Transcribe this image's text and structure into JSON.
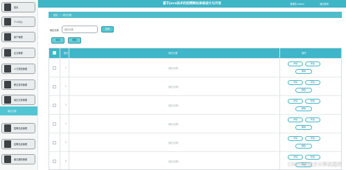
{
  "header": {
    "title": "基于java技术的招聘网站系统设计与开发",
    "user": "管理员 admin",
    "logout": "退出登录"
  },
  "sidebar": {
    "items": [
      {
        "label": "首页",
        "icon": "home-icon"
      },
      {
        "label": "个人中心",
        "icon": "user-icon"
      },
      {
        "label": "用户管理",
        "icon": "users-icon"
      },
      {
        "label": "企业管理",
        "icon": "building-icon"
      },
      {
        "label": "人才类型管理",
        "icon": "tag-icon"
      },
      {
        "label": "职位发布管理",
        "icon": "briefcase-icon"
      },
      {
        "label": "岗位分类管理",
        "icon": "folder-icon"
      }
    ],
    "submenu": {
      "label": "岗位分类"
    },
    "more_items": [
      {
        "label": "招聘信息管理",
        "icon": "list-icon"
      },
      {
        "label": "应聘信息管理",
        "icon": "file-icon"
      },
      {
        "label": "面试通知管理",
        "icon": "bell-icon"
      }
    ]
  },
  "breadcrumb": {
    "home": "首页",
    "sep": "/",
    "current": "岗位分类"
  },
  "search": {
    "label": "岗位分类",
    "placeholder": "岗位分类",
    "button": "查询"
  },
  "toolbar": {
    "add_label": "新增",
    "delete_label": "删除"
  },
  "table": {
    "columns": {
      "index": "索引",
      "name": "岗位分类",
      "actions": "操作"
    },
    "rows": [
      {
        "index": "1",
        "name": "岗位分类1"
      },
      {
        "index": "2",
        "name": "岗位分类2"
      },
      {
        "index": "3",
        "name": "岗位分类3"
      },
      {
        "index": "4",
        "name": "岗位分类4"
      },
      {
        "index": "5",
        "name": "岗位分类5"
      },
      {
        "index": "6",
        "name": "岗位分类6"
      }
    ],
    "actions": {
      "detail": "详情",
      "edit": "修改",
      "delete": "删除"
    }
  },
  "watermark": "CSDN @南方计算机程序",
  "colors": {
    "accent": "#3fb6c9",
    "sidebar_bg": "#f6f7f7"
  }
}
